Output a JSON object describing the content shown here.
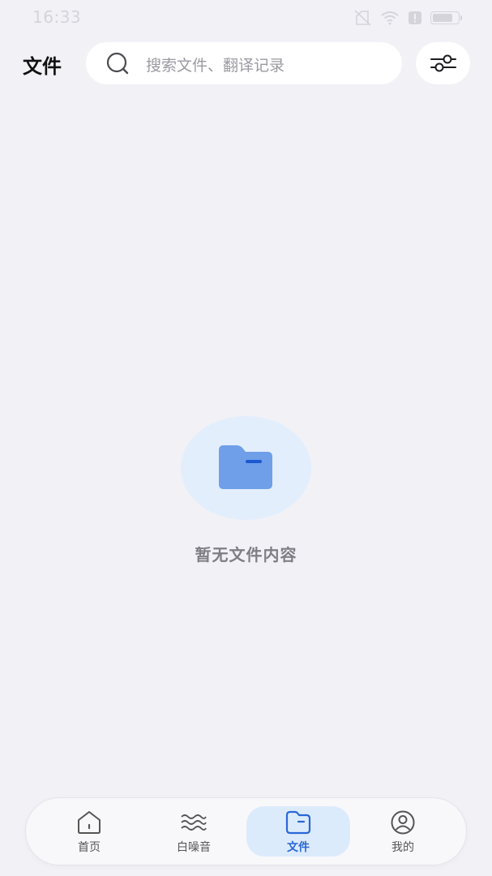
{
  "status_bar": {
    "time": "16:33",
    "battery": "77"
  },
  "header": {
    "title": "文件",
    "search_placeholder": "搜索文件、翻译记录"
  },
  "empty_state": {
    "message": "暂无文件内容"
  },
  "bottom_nav": {
    "items": [
      {
        "label": "首页",
        "icon": "home-icon",
        "active": false
      },
      {
        "label": "白噪音",
        "icon": "waves-icon",
        "active": false
      },
      {
        "label": "文件",
        "icon": "folder-icon",
        "active": true
      },
      {
        "label": "我的",
        "icon": "user-icon",
        "active": false
      }
    ]
  },
  "colors": {
    "background": "#f1f1f6",
    "accent": "#2a67d6",
    "active_tab_bg": "#dcebfc",
    "folder_fill": "#6f9fe8",
    "empty_circle": "#e3eefc"
  }
}
